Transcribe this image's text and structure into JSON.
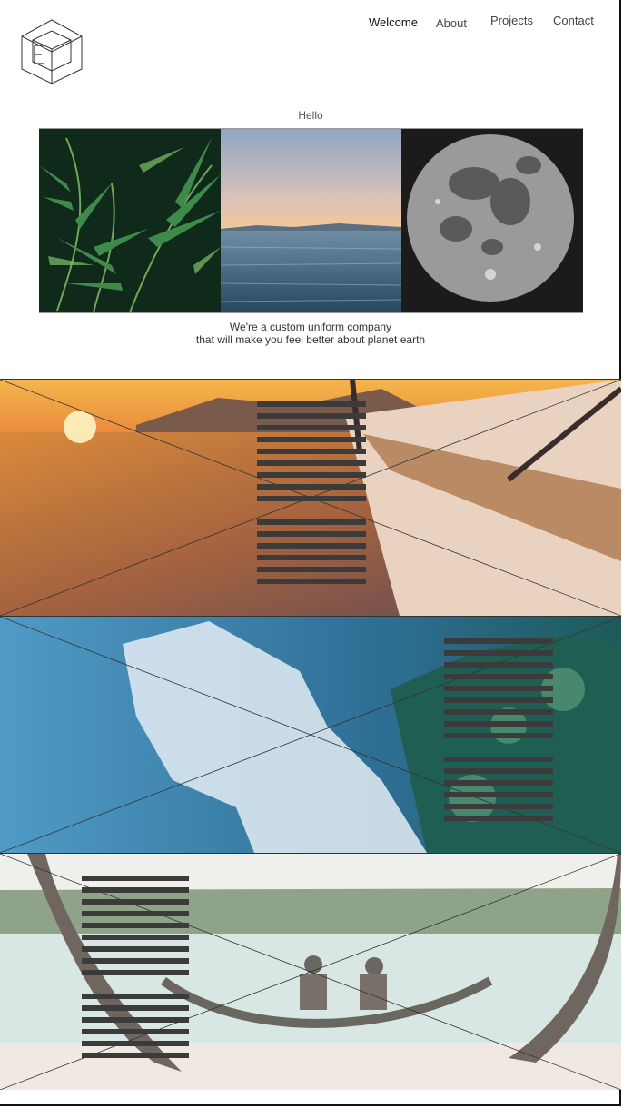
{
  "brand": {
    "logo": "cube-logo-icon"
  },
  "nav": {
    "items": [
      {
        "label": "Welcome",
        "active": true
      },
      {
        "label": "About",
        "active": false
      },
      {
        "label": "Projects",
        "active": false
      },
      {
        "label": "Contact",
        "active": false
      }
    ]
  },
  "intro": {
    "heading": "Hello",
    "images": [
      "palm-leaves-image",
      "ocean-sunset-image",
      "full-moon-image"
    ],
    "tagline_line1": "We're a custom uniform company",
    "tagline_line2": "that will make you feel better about planet earth"
  },
  "sections": [
    {
      "image": "sailboat-sunset-sea-image"
    },
    {
      "image": "plastic-bag-in-ocean-image"
    },
    {
      "image": "couple-in-hammock-beach-image"
    }
  ],
  "colors": {
    "text": "#333333",
    "bar": "#3b3b3b",
    "frame": "#111111"
  }
}
